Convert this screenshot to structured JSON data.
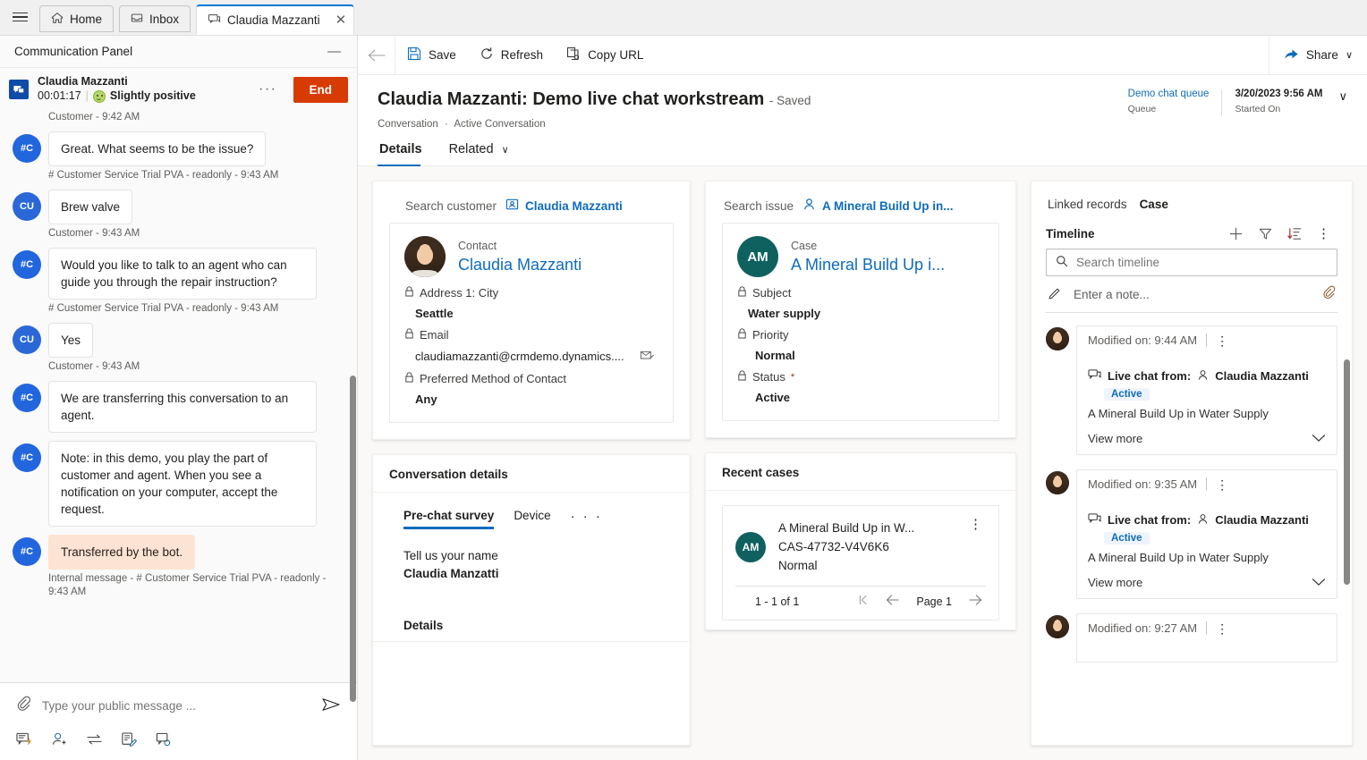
{
  "tabbar": {
    "menu_icon": "hamburger-icon",
    "tabs": [
      {
        "label": "Home",
        "icon": "home-icon",
        "active": false
      },
      {
        "label": "Inbox",
        "icon": "inbox-icon",
        "active": false
      },
      {
        "label": "Claudia Mazzanti",
        "icon": "chat-icon",
        "active": true,
        "close": "✕"
      }
    ]
  },
  "comm_panel": {
    "title": "Communication Panel",
    "minimize": "—",
    "conversation": {
      "customer_name": "Claudia Mazzanti",
      "timer": "00:01:17",
      "separator": "|",
      "sentiment": "Slightly positive",
      "sentiment_icon": "smiley-positive-icon",
      "more_label": "···",
      "end_label": "End"
    },
    "messages": [
      {
        "type": "stamp",
        "text": "Customer - 9:42 AM"
      },
      {
        "type": "bot",
        "avatar": "#C",
        "text": "Great. What seems to be the issue?"
      },
      {
        "type": "stamp",
        "text": "# Customer Service Trial PVA - readonly - 9:43 AM"
      },
      {
        "type": "customer",
        "avatar": "CU",
        "text": "Brew valve"
      },
      {
        "type": "stamp",
        "text": "Customer - 9:43 AM"
      },
      {
        "type": "bot",
        "avatar": "#C",
        "text": "Would you like to talk to an agent who can guide you through the repair instruction?"
      },
      {
        "type": "stamp",
        "text": "# Customer Service Trial PVA - readonly - 9:43 AM"
      },
      {
        "type": "customer",
        "avatar": "CU",
        "text": "Yes"
      },
      {
        "type": "stamp",
        "text": "Customer - 9:43 AM"
      },
      {
        "type": "bot",
        "avatar": "#C",
        "text": "We are transferring this conversation to an agent."
      },
      {
        "type": "bot",
        "avatar": "#C",
        "text": "Note: in this demo, you play the part of customer and agent. When you see a notification on your computer, accept the request."
      },
      {
        "type": "internal",
        "avatar": "#C",
        "text": "Transferred by the bot."
      },
      {
        "type": "stamp",
        "text": "Internal message - # Customer Service Trial PVA - readonly - 9:43 AM"
      }
    ],
    "composer": {
      "attach_icon": "paperclip-icon",
      "placeholder": "Type your public message ...",
      "send_icon": "send-icon",
      "tools": [
        "quick-reply-icon",
        "add-agent-icon",
        "transfer-icon",
        "notes-icon",
        "consult-icon"
      ]
    }
  },
  "command_bar": {
    "back_icon": "back-arrow-icon",
    "save": "Save",
    "refresh": "Refresh",
    "copy_url": "Copy URL",
    "share": "Share",
    "share_chevron": "∨"
  },
  "record": {
    "title": "Claudia Mazzanti: Demo live chat workstream",
    "saved_state": "- Saved",
    "breadcrumb_entity": "Conversation",
    "breadcrumb_sep": "·",
    "breadcrumb_view": "Active Conversation",
    "header_fields": [
      {
        "value": "Demo chat queue",
        "label": "Queue",
        "link": true
      },
      {
        "value": "3/20/2023 9:56 AM",
        "label": "Started On",
        "link": false
      }
    ],
    "header_chevron": "∨"
  },
  "form_tabs": [
    {
      "label": "Details",
      "active": true,
      "chevron": ""
    },
    {
      "label": "Related",
      "active": false,
      "chevron": "∨"
    }
  ],
  "customer_card": {
    "search_label": "Search customer",
    "search_icon": "contact-card-icon",
    "search_value": "Claudia Mazzanti",
    "entity_type": "Contact",
    "entity_name": "Claudia Mazzanti",
    "avatar": "contact-photo",
    "fields": [
      {
        "label": "Address 1: City",
        "value": "Seattle",
        "locked": true,
        "required": false,
        "action_icon": ""
      },
      {
        "label": "Email",
        "value": "claudiamazzanti@crmdemo.dynamics....",
        "locked": true,
        "required": false,
        "action_icon": "email-icon"
      },
      {
        "label": "Preferred Method of Contact",
        "value": "Any",
        "locked": true,
        "required": false,
        "action_icon": ""
      }
    ]
  },
  "case_card": {
    "search_label": "Search issue",
    "search_icon": "person-icon",
    "search_value": "A Mineral Build Up in...",
    "entity_type": "Case",
    "entity_name": "A Mineral Build Up i...",
    "initials": "AM",
    "fields": [
      {
        "label": "Subject",
        "value": "Water supply",
        "locked": true,
        "required": false
      },
      {
        "label": "Priority",
        "value": "Normal",
        "locked": true,
        "required": false
      },
      {
        "label": "Status",
        "value": "Active",
        "locked": true,
        "required": true
      }
    ]
  },
  "conversation_details": {
    "title": "Conversation details",
    "tabs": [
      {
        "label": "Pre-chat survey",
        "active": true
      },
      {
        "label": "Device",
        "active": false
      },
      {
        "label": "· · ·",
        "active": false,
        "overflow": true
      }
    ],
    "survey": [
      {
        "question": "Tell us your name",
        "answer": "Claudia Manzatti"
      }
    ],
    "details_heading": "Details"
  },
  "recent_cases": {
    "title": "Recent cases",
    "items": [
      {
        "initials": "AM",
        "title": "A Mineral Build Up in W...",
        "number": "CAS-47732-V4V6K6",
        "priority": "Normal",
        "kebab": "⋮"
      }
    ],
    "pager": {
      "count": "1 - 1 of 1",
      "first_icon": "first-page-icon",
      "prev_icon": "previous-page-icon",
      "page_label": "Page 1",
      "next_icon": "next-page-icon"
    }
  },
  "linked_records": {
    "label": "Linked records",
    "value": "Case"
  },
  "timeline": {
    "heading": "Timeline",
    "actions": [
      {
        "name": "add-record-icon",
        "glyph": "+"
      },
      {
        "name": "filter-icon",
        "glyph": "filter"
      },
      {
        "name": "sort-icon",
        "glyph": "sort"
      },
      {
        "name": "more-commands-icon",
        "glyph": "⋮"
      }
    ],
    "search_placeholder": "Search timeline",
    "search_icon": "search-icon",
    "note_placeholder": "Enter a note...",
    "note_icon": "pencil-icon",
    "note_attach_icon": "paperclip-icon",
    "items": [
      {
        "modified": "Modified on: 9:44 AM",
        "kebab": "⋮",
        "channel_icon": "live-chat-icon",
        "subject_prefix": "Live chat from:",
        "person_icon": "person-icon",
        "person": "Claudia Mazzanti",
        "status": "Active",
        "description": "A Mineral Build Up in Water Supply",
        "view_more": "View more",
        "chevron": "∨"
      },
      {
        "modified": "Modified on: 9:35 AM",
        "kebab": "⋮",
        "channel_icon": "live-chat-icon",
        "subject_prefix": "Live chat from:",
        "person_icon": "person-icon",
        "person": "Claudia Mazzanti",
        "status": "Active",
        "description": "A Mineral Build Up in Water Supply",
        "view_more": "View more",
        "chevron": "∨"
      },
      {
        "modified": "Modified on: 9:27 AM",
        "kebab": "⋮",
        "channel_icon": "",
        "subject_prefix": "",
        "person_icon": "",
        "person": "",
        "status": "",
        "description": "",
        "view_more": "",
        "chevron": ""
      }
    ]
  },
  "colors": {
    "accent": "#0f6cbd",
    "end_button": "#d83b01",
    "case_avatar": "#0f6160",
    "bot_avatar": "#2266dd",
    "internal_bubble": "#fde3d3",
    "badge": "#eef4fc"
  }
}
